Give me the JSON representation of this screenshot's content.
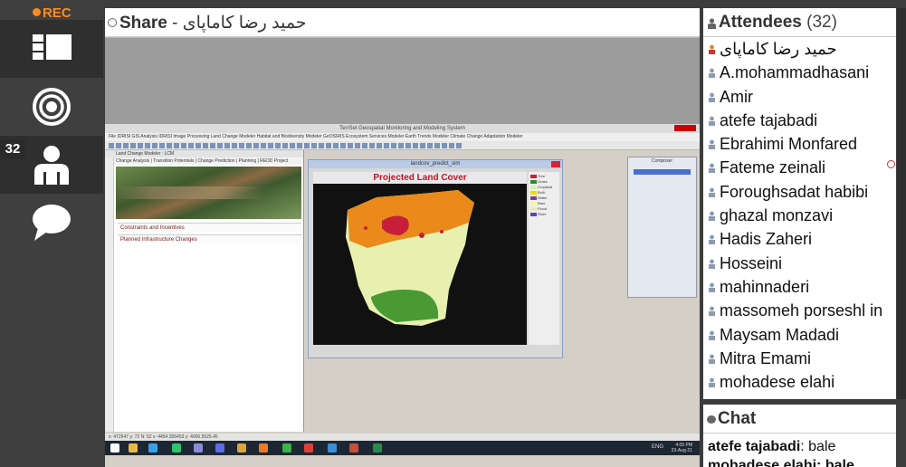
{
  "recording": {
    "label": "REC"
  },
  "rail": {
    "attendee_count": "32"
  },
  "share": {
    "title": "Share",
    "separator": " - ",
    "presenter": "حمید رضا کاماپای"
  },
  "gis": {
    "window_title": "TerrSet Geospatial Monitoring and Modeling System",
    "menu": "File   IDRISI GIS Analysis   IDRISI Image Processing   Land Change Modeler   Habitat and Biodiversity Modeler   GeOSIRIS   Ecosystem Services Modeler   Earth Trends Modeler   Climate Change Adaptation Modeler",
    "panel_header": "Land Change Modeler : LCM",
    "panel_tabs": "Change Analysis | Transition Potentials | Change Prediction | Planning | REDD Project",
    "items": [
      "Constraints and Incentives",
      "Planned Infrastructure Changes"
    ],
    "map_window_title": "landcov_predict_sim",
    "map_title": "Projected Land Cover",
    "legend": [
      {
        "label": "Tree",
        "color": "#c71f3a"
      },
      {
        "label": "Grass",
        "color": "#2d8a2d"
      },
      {
        "label": "Cropland",
        "color": "#d8f0b0"
      },
      {
        "label": "Built",
        "color": "#e8e000"
      },
      {
        "label": "Water",
        "color": "#8a3aa0"
      },
      {
        "label": "Bare",
        "color": "#f2f2a8"
      },
      {
        "label": "Flood",
        "color": "#e8e8c0"
      },
      {
        "label": "River",
        "color": "#5a44c8"
      }
    ],
    "composer_title": "Composer",
    "status": "x: 472547   y: 72   N:  52   x: 4454.355453   y: 4006.5525.45",
    "language": "ENG",
    "clock_time": "4:05 PM",
    "clock_date": "23-Aug-21"
  },
  "attendees": {
    "title": "Attendees",
    "count": "(32)",
    "list": [
      "حمید رضا کاماپای",
      "A.mohammadhasani",
      "Amir",
      "atefe tajabadi",
      "Ebrahimi Monfared",
      "Fateme zeinali",
      "Foroughsadat habibi",
      "ghazal monzavi",
      "Hadis Zaheri",
      "Hosseini",
      "mahinnaderi",
      "massomeh porseshl",
      "Maysam Madadi",
      "Mitra Emami",
      "mohadese elahi"
    ],
    "overflow_tail": "in"
  },
  "chat": {
    "title": "Chat",
    "messages": [
      {
        "author": "atefe tajabadi",
        "text": "bale"
      }
    ],
    "partial_line": "mohadese elahi: bale"
  }
}
